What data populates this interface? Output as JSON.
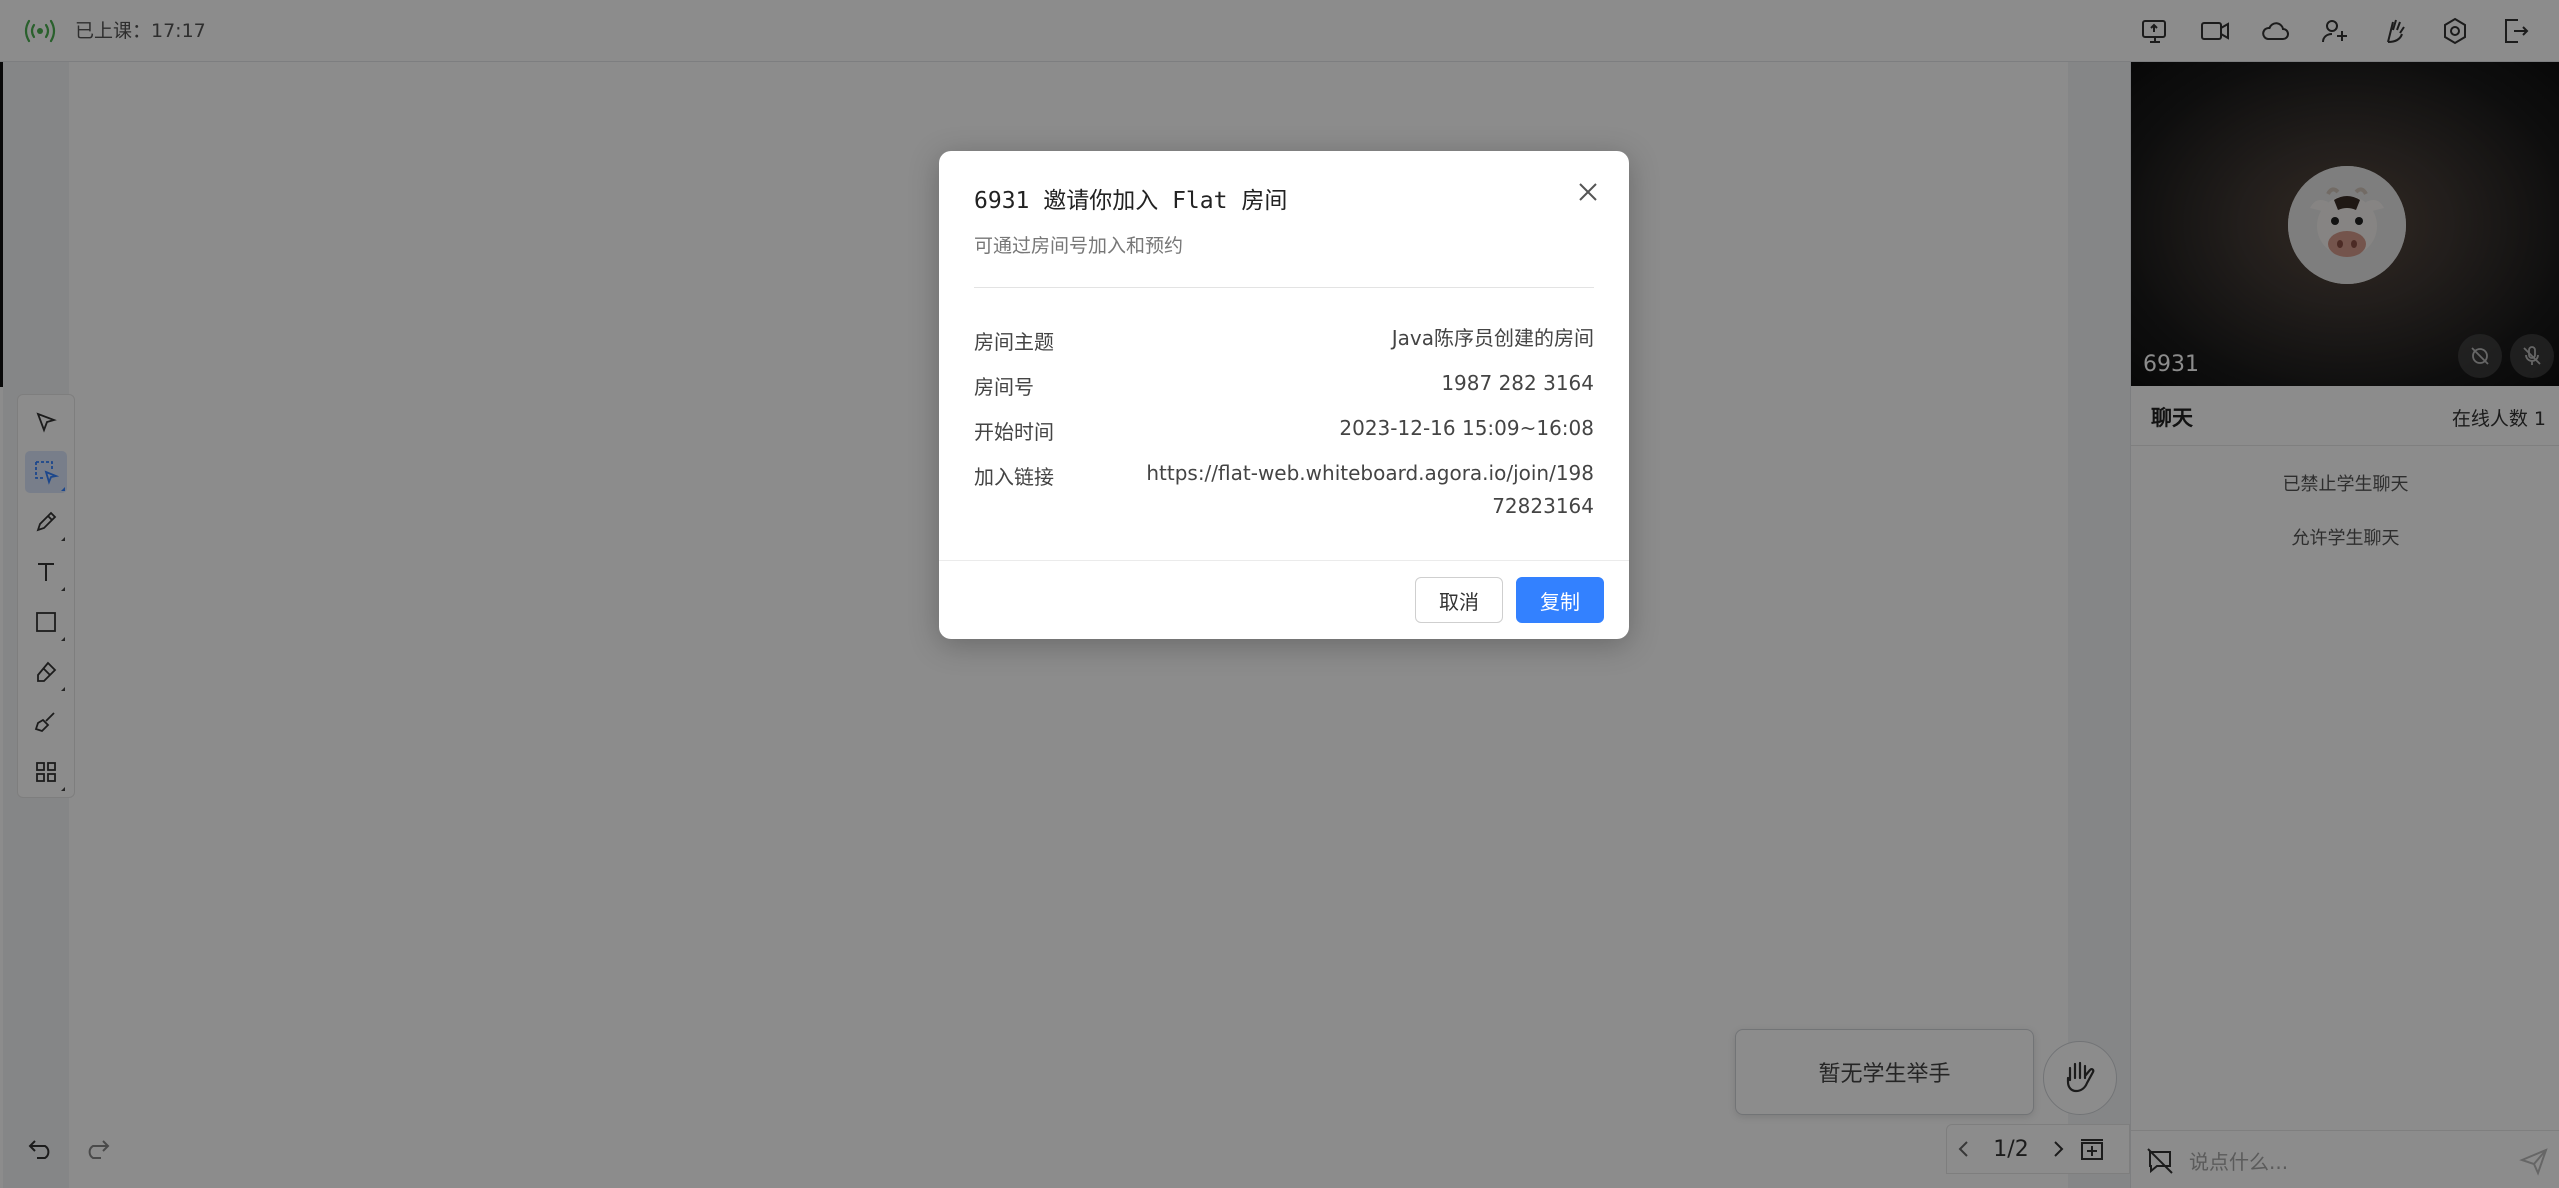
{
  "topbar": {
    "class_status": "已上课：17:17",
    "signal_color": "#4caf50",
    "tools": [
      {
        "name": "share-screen-icon"
      },
      {
        "name": "record-video-icon"
      },
      {
        "name": "cloud-storage-icon"
      },
      {
        "name": "invite-user-icon"
      },
      {
        "name": "hand-icon"
      },
      {
        "name": "settings-icon"
      },
      {
        "name": "exit-icon"
      }
    ]
  },
  "whiteboard": {
    "tools": [
      "selector-icon",
      "laser-select-icon",
      "pencil-icon",
      "text-icon",
      "rectangle-icon",
      "eraser-icon",
      "clear-icon",
      "apps-icon"
    ],
    "active_tool": "laser-select-icon",
    "accent_color": "#3381ff",
    "page_indicator": "1/2",
    "raise_hand_panel": "暂无学生举手"
  },
  "right_panel": {
    "video": {
      "user_name": "6931"
    },
    "chat": {
      "title": "聊天",
      "online_count": "在线人数 1",
      "messages": [
        "已禁止学生聊天",
        "允许学生聊天"
      ],
      "input_placeholder": "说点什么..."
    }
  },
  "modal": {
    "title": "6931 邀请你加入 Flat 房间",
    "subtitle": "可通过房间号加入和预约",
    "rows": [
      {
        "label": "房间主题",
        "value": "Java陈序员创建的房间"
      },
      {
        "label": "房间号",
        "value": "1987 282 3164"
      },
      {
        "label": "开始时间",
        "value": "2023-12-16 15:09~16:08"
      },
      {
        "label": "加入链接",
        "value": "https://flat-web.whiteboard.agora.io/join/19872823164"
      }
    ],
    "cancel_label": "取消",
    "copy_label": "复制",
    "primary_color": "#3381ff"
  }
}
